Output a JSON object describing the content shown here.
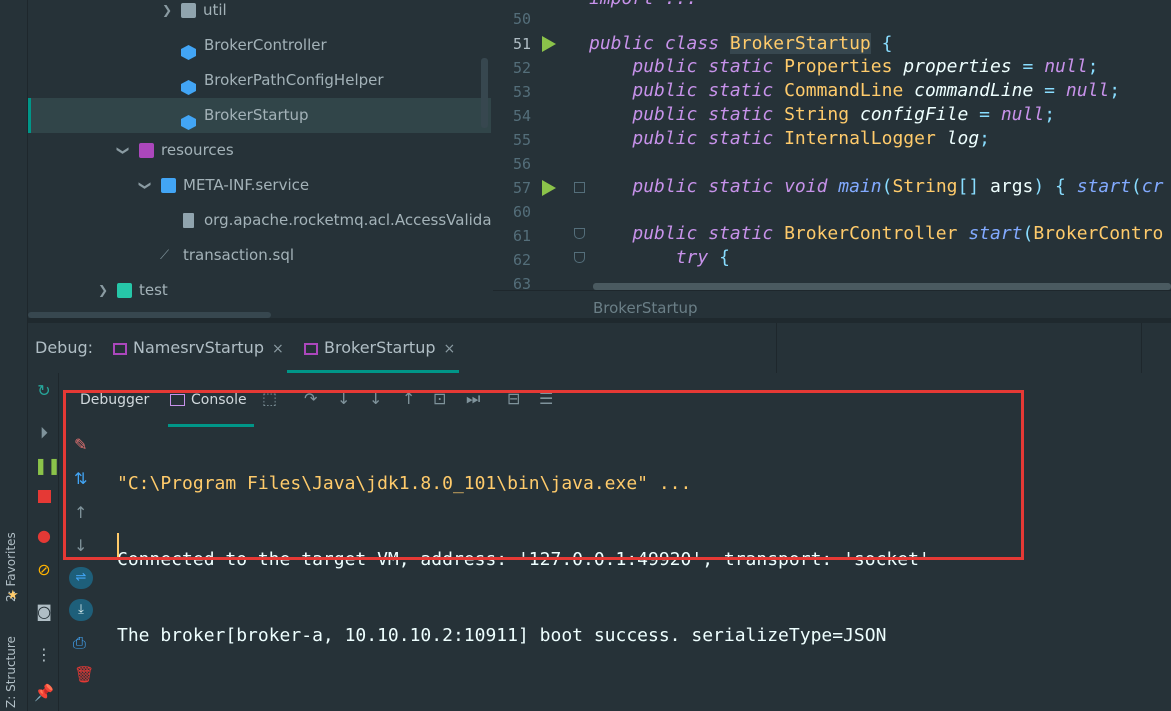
{
  "side_tabs": {
    "favorites": "2: Favorites",
    "structure": "Z: Structure"
  },
  "tree": {
    "items": [
      {
        "label": "util",
        "type": "folder"
      },
      {
        "label": "BrokerController",
        "type": "class"
      },
      {
        "label": "BrokerPathConfigHelper",
        "type": "class"
      },
      {
        "label": "BrokerStartup",
        "type": "class"
      },
      {
        "label": "resources",
        "type": "resources-folder"
      },
      {
        "label": "META-INF.service",
        "type": "folder"
      },
      {
        "label": "org.apache.rocketmq.acl.AccessValidato",
        "type": "file"
      },
      {
        "label": "transaction.sql",
        "type": "sql-file"
      },
      {
        "label": "test",
        "type": "test-folder"
      }
    ]
  },
  "editor": {
    "line_numbers": [
      "50",
      "51",
      "52",
      "53",
      "54",
      "55",
      "56",
      "57",
      "60",
      "61",
      "62",
      "63"
    ],
    "top_line": "import ...",
    "breadcrumb": "BrokerStartup"
  },
  "debug": {
    "label": "Debug:",
    "tabs": [
      {
        "label": "NamesrvStartup",
        "close": "×"
      },
      {
        "label": "BrokerStartup",
        "close": "×"
      }
    ],
    "subtabs": {
      "debugger": "Debugger",
      "console": "Console"
    },
    "console_lines": [
      "\"C:\\Program Files\\Java\\jdk1.8.0_101\\bin\\java.exe\" ...",
      "Connected to the target VM, address: '127.0.0.1:49920', transport: 'socket'",
      "The broker[broker-a, 10.10.10.2:10911] boot success. serializeType=JSON"
    ]
  },
  "colors": {
    "accent": "#009688",
    "highlight_box": "#e53935",
    "console_cmd": "#ffcb6b",
    "console_text": "#eeffff"
  }
}
